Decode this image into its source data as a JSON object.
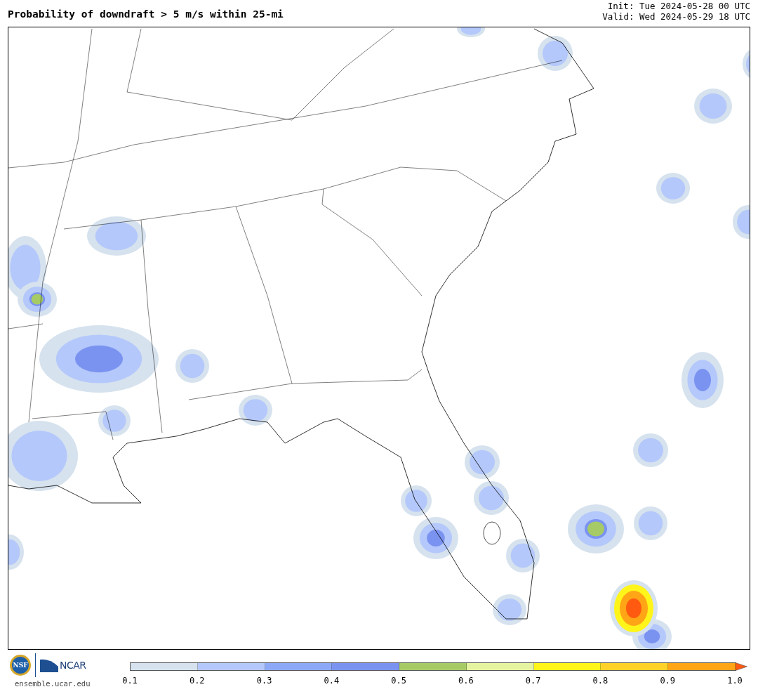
{
  "title": "Probability of downdraft > 5 m/s within 25-mi",
  "init": "Init: Tue 2024-05-28 00 UTC",
  "valid": "Valid: Wed 2024-05-29 18 UTC",
  "logos": {
    "nsf": "NSF",
    "ncar": "NCAR",
    "site": "ensemble.ucar.edu"
  },
  "colorbar": {
    "bins": [
      {
        "color": "#d6e2ee"
      },
      {
        "color": "#b4c8fb"
      },
      {
        "color": "#8da8f7"
      },
      {
        "color": "#7b93f0"
      },
      {
        "color": "#a6cb66"
      },
      {
        "color": "#e5f4a0"
      },
      {
        "color": "#fff51a"
      },
      {
        "color": "#ffd22a"
      },
      {
        "color": "#ffa516"
      },
      {
        "color": "#ff5a10",
        "kind": "arrow"
      }
    ],
    "ticks": [
      "0.1",
      "0.2",
      "0.3",
      "0.4",
      "0.5",
      "0.6",
      "0.7",
      "0.8",
      "0.9",
      "1.0"
    ]
  }
}
